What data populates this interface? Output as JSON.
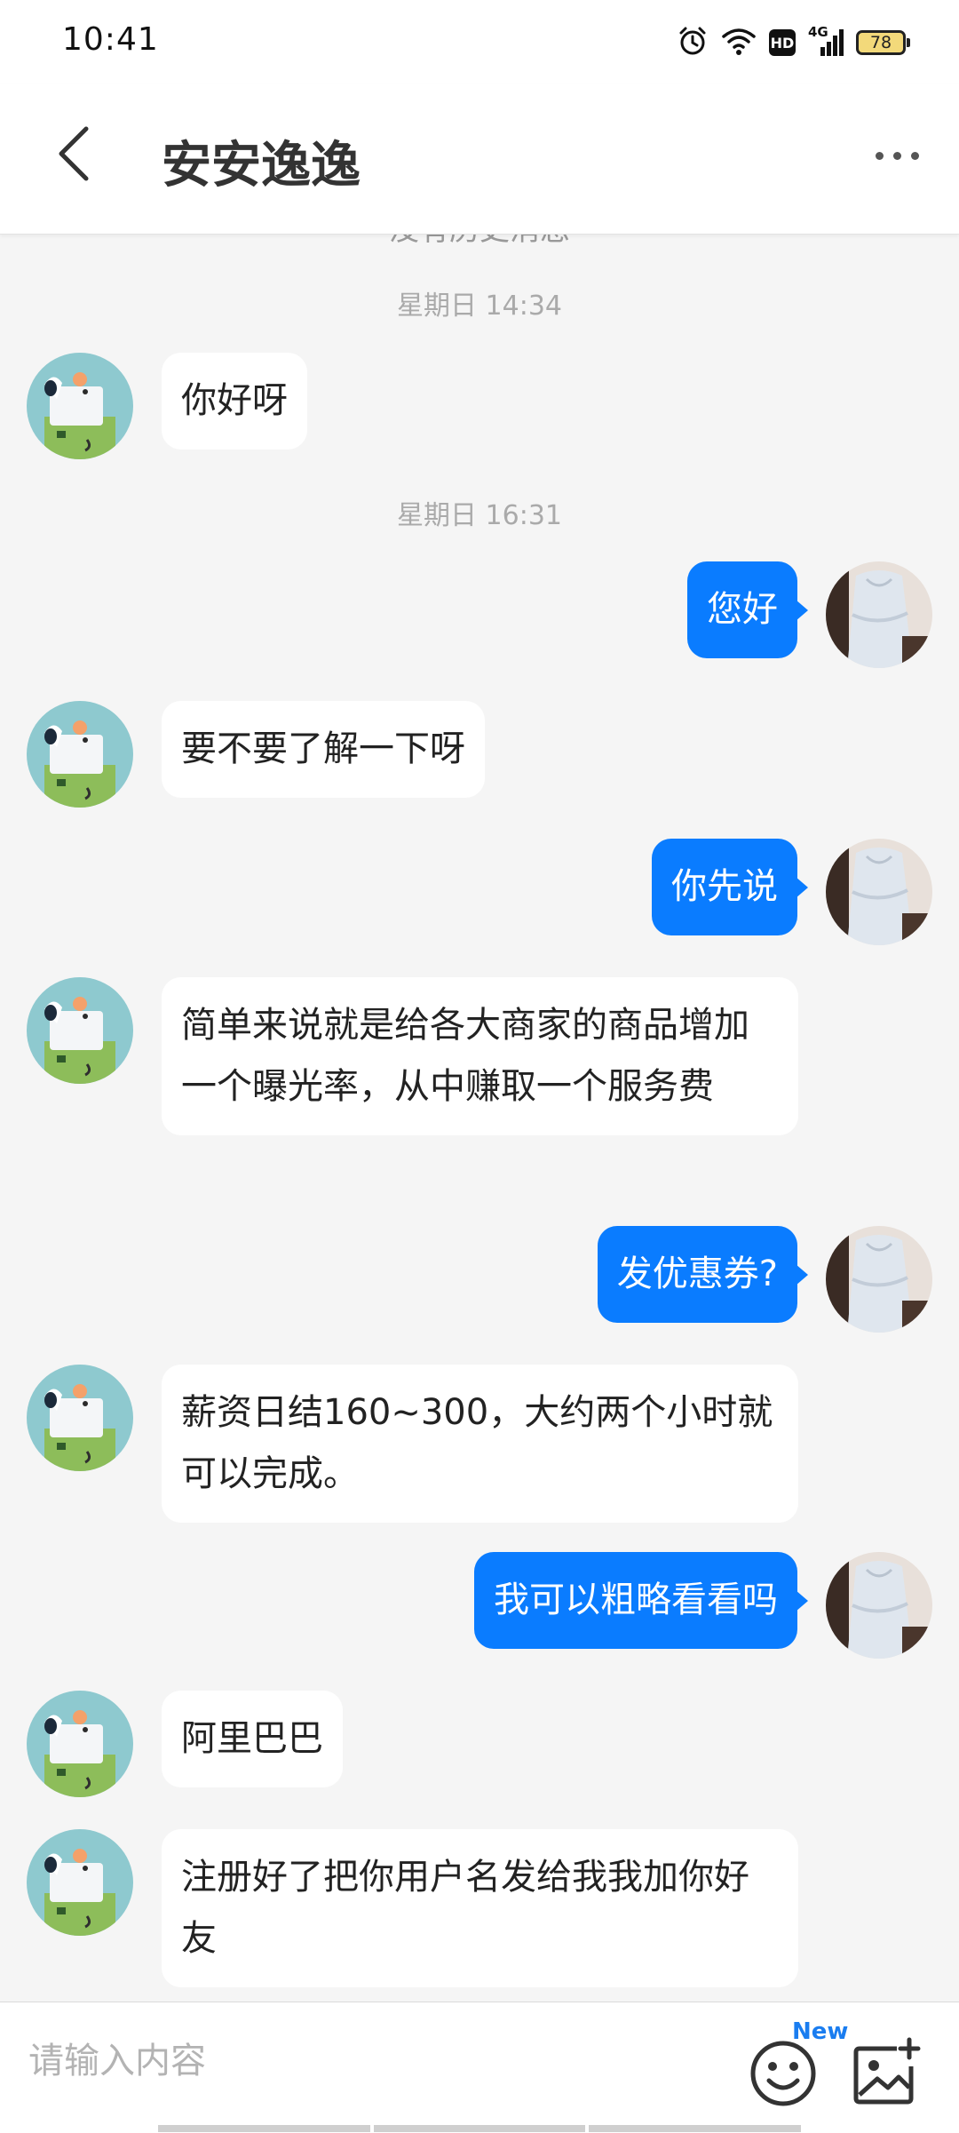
{
  "status_bar": {
    "time": "10:41",
    "network": "4G",
    "battery": "78",
    "icons": [
      "alarm-icon",
      "wifi-icon",
      "hd-icon",
      "signal-icon",
      "battery-icon"
    ]
  },
  "header": {
    "title": "安安逸逸",
    "icons": [
      "back-arrow-icon",
      "more-icon"
    ]
  },
  "chat": {
    "history_note": "没有历史消息",
    "timestamps": [
      "星期日 14:34",
      "星期日 16:31"
    ],
    "messages": [
      {
        "from": "other",
        "text": "你好呀"
      },
      {
        "from": "me",
        "text": "您好"
      },
      {
        "from": "other",
        "text": "要不要了解一下呀"
      },
      {
        "from": "me",
        "text": "你先说"
      },
      {
        "from": "other",
        "text": "简单来说就是给各大商家的商品增加一个曝光率，从中赚取一个服务费"
      },
      {
        "from": "me",
        "text": "发优惠券?"
      },
      {
        "from": "other",
        "text": "薪资日结160~300，大约两个小时就可以完成。"
      },
      {
        "from": "me",
        "text": "我可以粗略看看吗"
      },
      {
        "from": "other",
        "text": "阿里巴巴"
      },
      {
        "from": "other",
        "text": "注册好了把你用户名发给我我加你好友"
      }
    ]
  },
  "input_bar": {
    "placeholder": "请输入内容",
    "new_badge": "New",
    "icons": [
      "emoji-icon",
      "add-image-icon"
    ]
  },
  "colors": {
    "outgoing_bubble": "#0a7cff",
    "incoming_bubble": "#ffffff",
    "background": "#f5f5f5",
    "new_badge": "#1a7df0"
  }
}
